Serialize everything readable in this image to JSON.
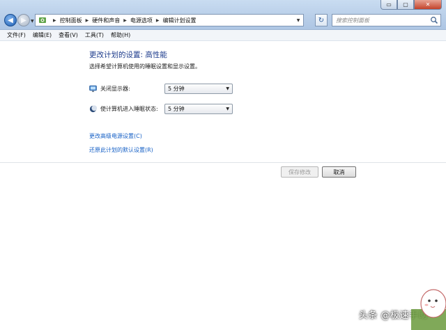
{
  "window": {
    "minimize_glyph": "▭",
    "maximize_glyph": "▢",
    "close_glyph": "✕"
  },
  "address_bar": {
    "breadcrumbs": [
      "控制面板",
      "硬件和声音",
      "电源选项",
      "编辑计划设置"
    ]
  },
  "search": {
    "placeholder": "搜索控制面板"
  },
  "menu": [
    "文件(F)",
    "编辑(E)",
    "查看(V)",
    "工具(T)",
    "帮助(H)"
  ],
  "main": {
    "title": "更改计划的设置: 高性能",
    "description": "选择希望计算机使用的睡眠设置和显示设置。",
    "settings": [
      {
        "label": "关闭显示器:",
        "value": "5 分钟",
        "icon": "monitor-icon"
      },
      {
        "label": "使计算机进入睡眠状态:",
        "value": "5 分钟",
        "icon": "moon-icon"
      }
    ],
    "links": [
      "更改高级电源设置(C)",
      "还原此计划的默认设置(R)"
    ],
    "buttons": {
      "save": "保存修改",
      "cancel": "取消"
    }
  },
  "watermark": "头条 @极速手助",
  "colors": {
    "title": "#1b3a8b",
    "link": "#1660c6",
    "chrome": "#b9cfe9"
  }
}
